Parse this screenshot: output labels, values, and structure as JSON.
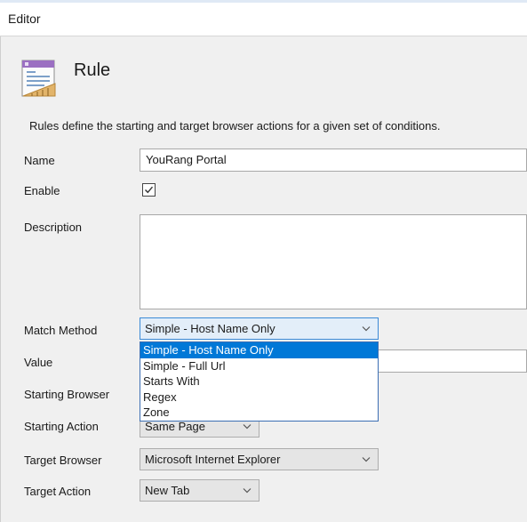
{
  "window": {
    "title": "Editor"
  },
  "header": {
    "icon": "rule-document-icon",
    "heading": "Rule",
    "description": "Rules define the starting and target browser actions for a given set of conditions."
  },
  "form": {
    "name": {
      "label": "Name",
      "value": "YouRang Portal"
    },
    "enable": {
      "label": "Enable",
      "checked": true
    },
    "description": {
      "label": "Description",
      "value": ""
    },
    "match_method": {
      "label": "Match Method",
      "value": "Simple - Host Name Only",
      "options": [
        "Simple - Host Name Only",
        "Simple - Full Url",
        "Starts With",
        "Regex",
        "Zone"
      ],
      "open": true
    },
    "value": {
      "label": "Value",
      "value": ""
    },
    "starting_browser": {
      "label": "Starting Browser"
    },
    "starting_action": {
      "label": "Starting Action",
      "value": "Same Page"
    },
    "target_browser": {
      "label": "Target Browser",
      "value": "Microsoft Internet Explorer"
    },
    "target_action": {
      "label": "Target Action",
      "value": "New Tab"
    }
  },
  "colors": {
    "selection": "#0078d7",
    "focus_border": "#3b8ad7",
    "window_bg": "#f0f0f0"
  }
}
